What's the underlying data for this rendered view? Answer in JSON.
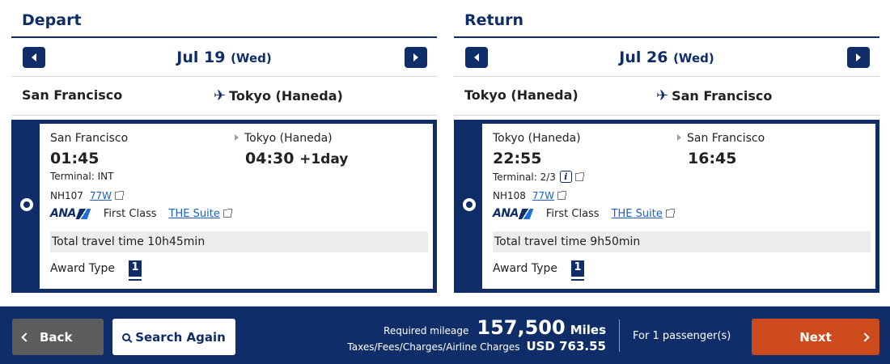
{
  "depart": {
    "title": "Depart",
    "date": "Jul 19",
    "dow": "(Wed)",
    "route_from": "San Francisco",
    "route_to": "Tokyo (Haneda)",
    "flight": {
      "origin": "San Francisco",
      "destination": "Tokyo (Haneda)",
      "dep_time": "01:45",
      "arr_time": "04:30",
      "arr_offset": "+1day",
      "terminal": "Terminal: INT",
      "flight_no": "NH107",
      "aircraft": "77W",
      "airline": "ANA",
      "cabin": "First Class",
      "seat": "THE Suite",
      "travel_time": "Total travel time 10h45min",
      "award_label": "Award Type",
      "award_value": "1"
    }
  },
  "return": {
    "title": "Return",
    "date": "Jul 26",
    "dow": "(Wed)",
    "route_from": "Tokyo (Haneda)",
    "route_to": "San Francisco",
    "flight": {
      "origin": "Tokyo (Haneda)",
      "destination": "San Francisco",
      "dep_time": "22:55",
      "arr_time": "16:45",
      "terminal": "Terminal: 2/3",
      "info_glyph": "i",
      "flight_no": "NH108",
      "aircraft": "77W",
      "airline": "ANA",
      "cabin": "First Class",
      "seat": "THE Suite",
      "travel_time": "Total travel time 9h50min",
      "award_label": "Award Type",
      "award_value": "1"
    }
  },
  "footer": {
    "back_label": "Back",
    "search_again_label": "Search Again",
    "required_mileage_label": "Required mileage",
    "miles_value": "157,500",
    "miles_unit": "Miles",
    "taxes_label": "Taxes/Fees/Charges/Airline Charges",
    "taxes_value": "USD  763.55",
    "passengers": "For 1 passenger(s)",
    "next_label": "Next"
  },
  "icons": {
    "plane": "✈",
    "search": "search-icon",
    "external": "external-link-icon"
  },
  "colors": {
    "brand_navy": "#0f2d69",
    "next_orange": "#cc4a1c",
    "back_gray": "#5c5c5c",
    "link_blue": "#1b5fc4"
  }
}
